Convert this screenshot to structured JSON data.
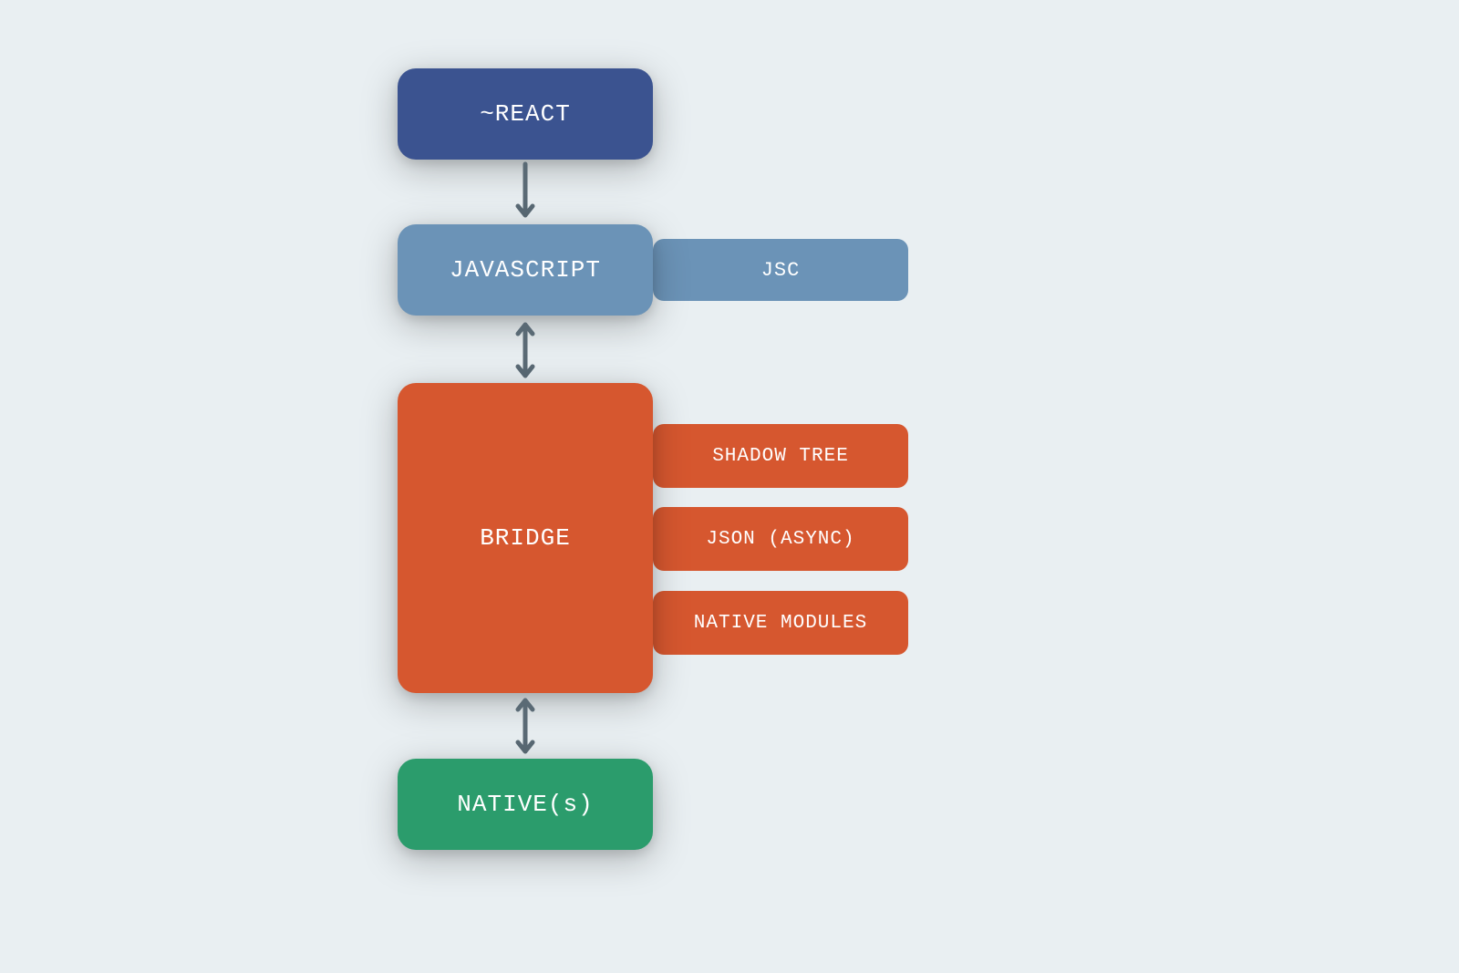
{
  "nodes": {
    "react": "~REACT",
    "javascript": "JAVASCRIPT",
    "jsc": "JSC",
    "bridge": "BRIDGE",
    "bridge_subs": [
      "SHADOW TREE",
      "JSON (ASYNC)",
      "NATIVE MODULES"
    ],
    "native": "NATIVE(s)"
  },
  "colors": {
    "bg": "#e9eff2",
    "react": "#3b5390",
    "javascript": "#6b93b7",
    "bridge": "#d6572f",
    "native": "#2b9c6c",
    "arrow": "#5a6a75"
  }
}
